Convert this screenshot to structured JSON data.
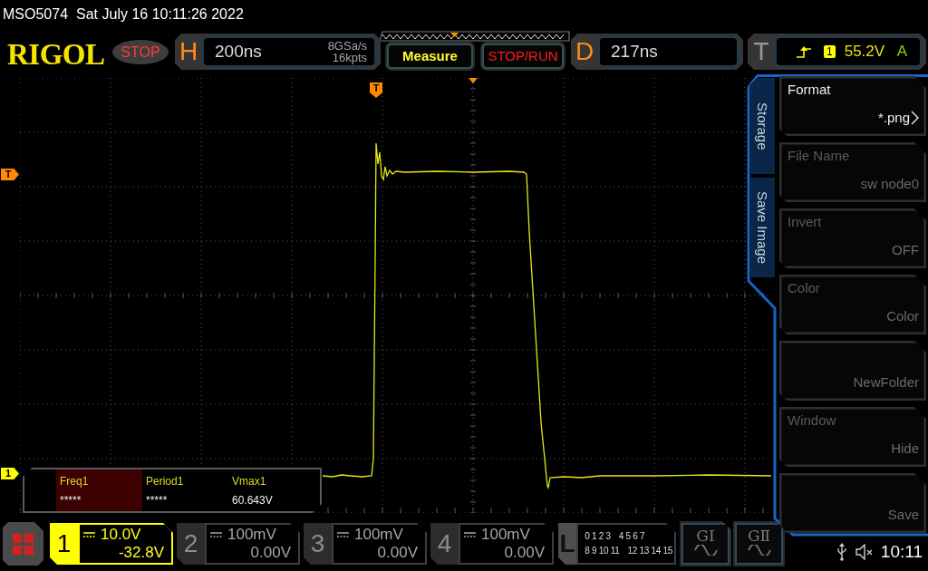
{
  "status_line": {
    "model": "MSO5074",
    "datetime": "Sat July 16 10:11:26 2022"
  },
  "header": {
    "brand": "RIGOL",
    "run_state": "STOP",
    "horizontal": {
      "letter": "H",
      "timebase": "200ns",
      "sample_rate": "8GSa/s",
      "memory_depth": "16kpts"
    },
    "buttons": [
      {
        "kind": "measure",
        "label": "Measure"
      },
      {
        "kind": "run",
        "label": "STOP/RUN"
      }
    ],
    "delay": {
      "letter": "D",
      "value": "217ns"
    },
    "trigger": {
      "letter": "T",
      "source": "1",
      "level": "55.2V",
      "sweep": "A"
    }
  },
  "plot": {
    "trigger_position_marker": "T",
    "trigger_level_marker": "T",
    "channel_marker": "1",
    "measurements": [
      {
        "label": "Freq1",
        "value": "*****",
        "selected": true
      },
      {
        "label": "Period1",
        "value": "*****",
        "selected": false
      },
      {
        "label": "Vmax1",
        "value": "60.643V",
        "selected": false
      }
    ]
  },
  "menu": {
    "path": [
      "Storage",
      "Save Image"
    ],
    "items": [
      {
        "label": "Format",
        "value": "*.png",
        "submenu": true,
        "disabled": false
      },
      {
        "label": "File Name",
        "value": "sw node0",
        "submenu": false,
        "disabled": true
      },
      {
        "label": "Invert",
        "value": "OFF",
        "submenu": false,
        "disabled": true
      },
      {
        "label": "Color",
        "value": "Color",
        "submenu": false,
        "disabled": true
      },
      {
        "value": "NewFolder",
        "submenu": false,
        "disabled": true
      },
      {
        "label": "Window",
        "value": "Hide",
        "submenu": false,
        "disabled": true
      },
      {
        "value": "Save",
        "submenu": false,
        "disabled": true
      }
    ]
  },
  "channels": [
    {
      "number": "1",
      "scale": "10.0V",
      "offset": "-32.8V",
      "on": true
    },
    {
      "number": "2",
      "scale": "100mV",
      "offset": "0.00V",
      "on": false
    },
    {
      "number": "3",
      "scale": "100mV",
      "offset": "0.00V",
      "on": false
    },
    {
      "number": "4",
      "scale": "100mV",
      "offset": "0.00V",
      "on": false
    }
  ],
  "logic": {
    "letter": "L",
    "rows": [
      [
        "0 1 2 3",
        "4 5 6 7"
      ],
      [
        "8 9 10 11",
        "12 13 14 15"
      ]
    ]
  },
  "generators": [
    {
      "label": "GⅠ"
    },
    {
      "label": "GⅡ"
    }
  ],
  "status_bar": {
    "muted": true,
    "time": "10:11"
  }
}
